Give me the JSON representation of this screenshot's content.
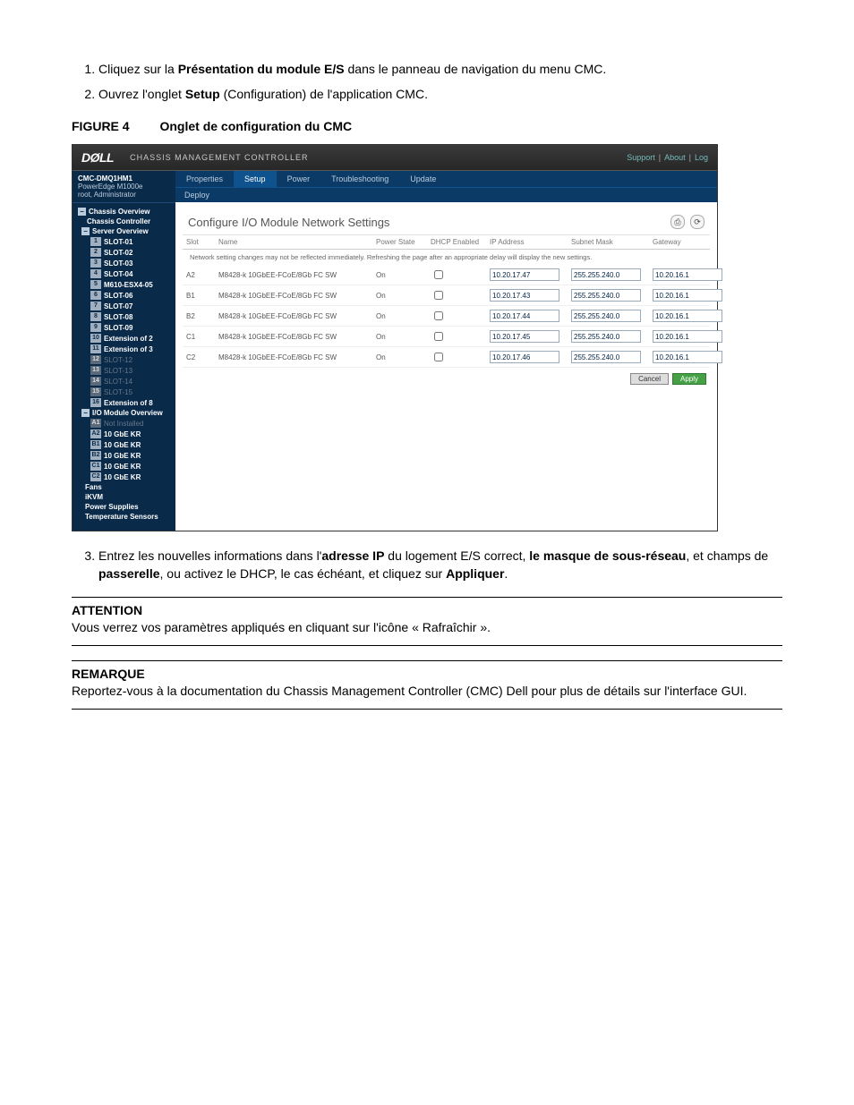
{
  "steps": {
    "s1_a": "Cliquez sur la ",
    "s1_b": "Présentation du module E/S",
    "s1_c": " dans le panneau de navigation du menu CMC.",
    "s2_a": "Ouvrez l'onglet ",
    "s2_b": "Setup",
    "s2_c": " (Configuration) de l'application CMC.",
    "s3_a": "Entrez les nouvelles informations dans l'",
    "s3_b": "adresse IP",
    "s3_c": " du logement E/S correct, ",
    "s3_d": "le masque de sous-réseau",
    "s3_e": ", et champs de ",
    "s3_f": "passerelle",
    "s3_g": ", ou activez le DHCP, le cas échéant, et cliquez sur ",
    "s3_h": "Appliquer",
    "s3_i": "."
  },
  "figure": {
    "label": "FIGURE 4",
    "title": "Onglet de configuration du CMC"
  },
  "attention": {
    "heading": "ATTENTION",
    "text": "Vous verrez vos paramètres appliqués en cliquant sur l'icône « Rafraîchir »."
  },
  "remarque": {
    "heading": "REMARQUE",
    "text": "Reportez-vous à la documentation du Chassis Management Controller (CMC) Dell pour plus de détails sur l'interface GUI."
  },
  "cmc": {
    "logo": "DØLL",
    "appTitle": "CHASSIS MANAGEMENT CONTROLLER",
    "headerLinks": {
      "support": "Support",
      "about": "About",
      "log": "Log"
    },
    "sidebarTop": {
      "host": "CMC-DMQ1HM1",
      "model": "PowerEdge M1000e",
      "user": "root, Administrator"
    },
    "tree": {
      "chassisOverview": "Chassis Overview",
      "chassisController": "Chassis Controller",
      "serverOverview": "Server Overview",
      "slots": [
        {
          "tag": "1",
          "label": "SLOT-01"
        },
        {
          "tag": "2",
          "label": "SLOT-02"
        },
        {
          "tag": "3",
          "label": "SLOT-03"
        },
        {
          "tag": "4",
          "label": "SLOT-04"
        },
        {
          "tag": "5",
          "label": "M610-ESX4-05"
        },
        {
          "tag": "6",
          "label": "SLOT-06"
        },
        {
          "tag": "7",
          "label": "SLOT-07"
        },
        {
          "tag": "8",
          "label": "SLOT-08"
        },
        {
          "tag": "9",
          "label": "SLOT-09"
        },
        {
          "tag": "10",
          "label": "Extension of 2"
        },
        {
          "tag": "11",
          "label": "Extension of 3"
        },
        {
          "tag": "12",
          "label": "SLOT-12",
          "dim": true
        },
        {
          "tag": "13",
          "label": "SLOT-13",
          "dim": true
        },
        {
          "tag": "14",
          "label": "SLOT-14",
          "dim": true
        },
        {
          "tag": "15",
          "label": "SLOT-15",
          "dim": true
        },
        {
          "tag": "16",
          "label": "Extension of 8"
        }
      ],
      "ioModuleOverview": "I/O Module Overview",
      "iom": [
        {
          "tag": "A1",
          "label": "Not Installed",
          "dim": true
        },
        {
          "tag": "A2",
          "label": "10 GbE KR"
        },
        {
          "tag": "B1",
          "label": "10 GbE KR"
        },
        {
          "tag": "B2",
          "label": "10 GbE KR"
        },
        {
          "tag": "C1",
          "label": "10 GbE KR"
        },
        {
          "tag": "C2",
          "label": "10 GbE KR"
        }
      ],
      "fans": "Fans",
      "ikvm": "iKVM",
      "power": "Power Supplies",
      "temp": "Temperature Sensors"
    },
    "tabs": [
      "Properties",
      "Setup",
      "Power",
      "Troubleshooting",
      "Update"
    ],
    "activeTab": "Setup",
    "subtab": "Deploy",
    "contentTitle": "Configure I/O Module Network Settings",
    "gridHeaders": [
      "Slot",
      "Name",
      "Power State",
      "DHCP Enabled",
      "IP Address",
      "Subnet Mask",
      "Gateway"
    ],
    "gridNote": "Network setting changes may not be reflected immediately. Refreshing the page after an appropriate delay will display the new settings.",
    "rows": [
      {
        "slot": "A2",
        "name": "M8428-k 10GbEE-FCoE/8Gb FC SW",
        "power": "On",
        "ip": "10.20.17.47",
        "mask": "255.255.240.0",
        "gw": "10.20.16.1"
      },
      {
        "slot": "B1",
        "name": "M8428-k 10GbEE-FCoE/8Gb FC SW",
        "power": "On",
        "ip": "10.20.17.43",
        "mask": "255.255.240.0",
        "gw": "10.20.16.1"
      },
      {
        "slot": "B2",
        "name": "M8428-k 10GbEE-FCoE/8Gb FC SW",
        "power": "On",
        "ip": "10.20.17.44",
        "mask": "255.255.240.0",
        "gw": "10.20.16.1"
      },
      {
        "slot": "C1",
        "name": "M8428-k 10GbEE-FCoE/8Gb FC SW",
        "power": "On",
        "ip": "10.20.17.45",
        "mask": "255.255.240.0",
        "gw": "10.20.16.1"
      },
      {
        "slot": "C2",
        "name": "M8428-k 10GbEE-FCoE/8Gb FC SW",
        "power": "On",
        "ip": "10.20.17.46",
        "mask": "255.255.240.0",
        "gw": "10.20.16.1"
      }
    ],
    "buttons": {
      "cancel": "Cancel",
      "apply": "Apply"
    }
  }
}
